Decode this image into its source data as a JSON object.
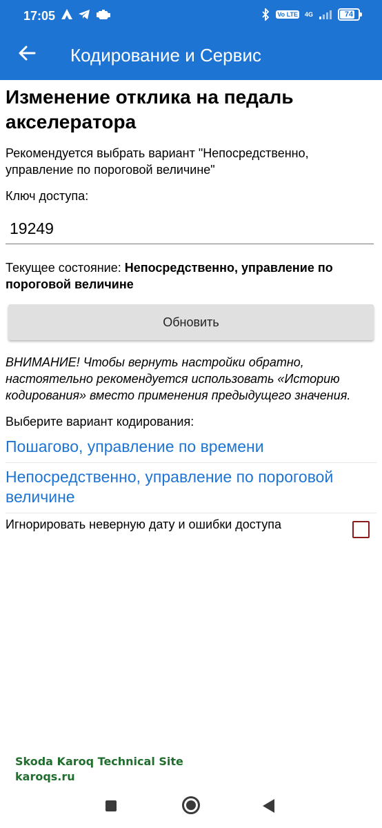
{
  "status_bar": {
    "time": "17:05",
    "network_label": "4G",
    "volte_label": "Vo LTE",
    "battery_level": "74"
  },
  "app_bar": {
    "title": "Кодирование и Сервис"
  },
  "content": {
    "heading": "Изменение отклика на педаль акселератора",
    "recommendation": "Рекомендуется выбрать вариант \"Непосредственно, управление по пороговой величине\"",
    "access_key_label": "Ключ доступа:",
    "access_key_value": "19249",
    "current_state_label": "Текущее состояние: ",
    "current_state_value": "Непосредственно, управление по пороговой величине",
    "refresh_button": "Обновить",
    "warning": "ВНИМАНИЕ! Чтобы вернуть настройки обратно, настоятельно рекомендуется использовать «Историю кодирования» вместо применения предыдущего значения.",
    "choose_label": "Выберите вариант кодирования:",
    "options": [
      "Пошагово, управление по времени",
      "Непосредственно, управление по пороговой величине"
    ],
    "ignore_label": "Игнорировать неверную дату и ошибки доступа",
    "ignore_checked": false
  },
  "watermark": {
    "line1": "Skoda Karoq Technical Site",
    "line2": "karoqs.ru"
  },
  "colors": {
    "primary": "#1e74d3",
    "link": "#1e74d3",
    "checkbox_border": "#8b1a1a",
    "button_bg": "#e0e0e0",
    "watermark": "#1f6e2d"
  }
}
